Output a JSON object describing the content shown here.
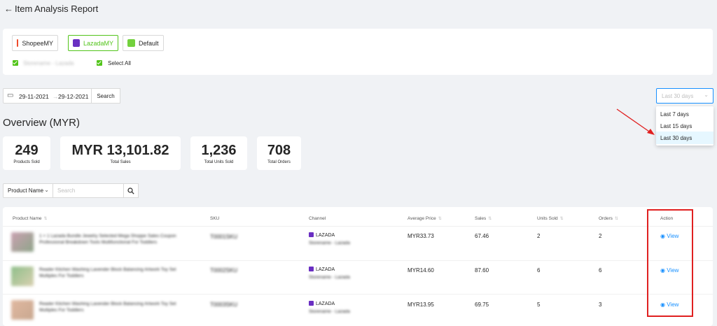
{
  "header": {
    "back": "←",
    "title": "Item Analysis Report"
  },
  "shops": [
    {
      "label": "ShopeeMY",
      "active": false,
      "color": "#ee4d2d"
    },
    {
      "label": "LazadaMY",
      "active": true,
      "color": "#6a2fc2"
    },
    {
      "label": "Default",
      "active": false,
      "color": "#73d13d"
    }
  ],
  "store_checkbox": {
    "label": "Storename - Lazada",
    "checked": true
  },
  "select_all": {
    "label": "Select All",
    "checked": true
  },
  "date_range": {
    "start": "29-11-2021",
    "sep": "→",
    "end": "29-12-2021",
    "search_label": "Search"
  },
  "period": {
    "value": "Last 30 days",
    "options": [
      "Last 7 days",
      "Last 15 days",
      "Last 30 days"
    ],
    "selected": "Last 30 days"
  },
  "overview": {
    "title": "Overview (MYR)",
    "stats": [
      {
        "value": "249",
        "label": "Products Sold"
      },
      {
        "value": "MYR 13,101.82",
        "label": "Total Sales"
      },
      {
        "value": "1,236",
        "label": "Total Units Sold"
      },
      {
        "value": "708",
        "label": "Total Orders"
      }
    ]
  },
  "filter": {
    "field": "Product Name",
    "placeholder": "Search"
  },
  "table": {
    "headers": [
      "Product Name",
      "SKU",
      "Channel",
      "Average Price",
      "Sales",
      "Units Sold",
      "Orders",
      "Action"
    ],
    "rows": [
      {
        "name": "1 + 1 Lazada Bundle Jewelry Selected Mega Shoppe Sales Coupon Professional Breakdown Tools Multifunctional For Toddlers",
        "sku": "T0001SKU",
        "channel": "LAZADA",
        "store": "Storename - Lazada",
        "avg_price": "MYR33.73",
        "sales": "67.46",
        "units": "2",
        "orders": "2",
        "action": "View"
      },
      {
        "name": "Reader Kitchen Washing Lavender Block Balancing Artwork Toy Set Multiples For Toddlers",
        "sku": "T0002SKU",
        "channel": "LAZADA",
        "store": "Storename - Lazada",
        "avg_price": "MYR14.60",
        "sales": "87.60",
        "units": "6",
        "orders": "6",
        "action": "View"
      },
      {
        "name": "Reader Kitchen Washing Lavender Block Balancing Artwork Toy Set Multiples For Toddlers",
        "sku": "T0003SKU",
        "channel": "LAZADA",
        "store": "Storename - Lazada",
        "avg_price": "MYR13.95",
        "sales": "69.75",
        "units": "5",
        "orders": "3",
        "action": "View"
      }
    ]
  },
  "colors": {
    "accent": "#1890ff",
    "active_green": "#52c41a",
    "highlight_red": "#e02020"
  }
}
